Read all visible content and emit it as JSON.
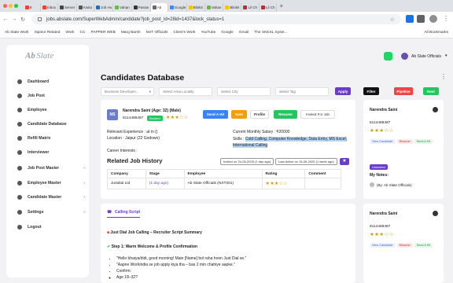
{
  "browser": {
    "tabs": [
      {
        "label": "8",
        "fav": "#ea4335"
      },
      {
        "label": "Inbox",
        "fav": "#ea4335"
      },
      {
        "label": "Server",
        "fav": "#444"
      },
      {
        "label": "Kwita",
        "fav": "#555"
      },
      {
        "label": "Job Ho",
        "fav": "#2b6cb0"
      },
      {
        "label": "Vahan",
        "fav": "#6b4"
      },
      {
        "label": "Passw",
        "fav": "#333"
      },
      {
        "label": "Ab",
        "fav": "#666",
        "active": true
      },
      {
        "label": "Google",
        "fav": "#4285f4"
      },
      {
        "label": "Blinkit",
        "fav": "#f7c600"
      },
      {
        "label": "Vahan",
        "fav": "#6b4"
      },
      {
        "label": "Blinkit",
        "fav": "#f7c600"
      },
      {
        "label": "Lil Ch",
        "fav": "#a33"
      },
      {
        "label": "Lil Ch",
        "fav": "#a33"
      }
    ],
    "new_tab": "+",
    "url": "jobs.abslate.com/SuperWebAdmin/candidate?job_post_id=28id=1437&lock_status=1",
    "bookmarks": [
      "Ab Slate Work",
      "Sipinor Related",
      "Work",
      "CC",
      "PAPPER WEB",
      "Marg Barsh",
      "NST Officials",
      "Client's Work",
      "YouTube",
      "Google",
      "Gmail",
      "The SKESL Syste..."
    ],
    "all_bookmarks": "All Bookmarks"
  },
  "sidebar": {
    "logo_a": "Ab",
    "logo_b": "Slate",
    "items": [
      {
        "label": "Dashboard",
        "chevron": false
      },
      {
        "label": "Job Post",
        "chevron": false
      },
      {
        "label": "Employee",
        "chevron": false
      },
      {
        "label": "Candidate Database",
        "chevron": false
      },
      {
        "label": "Refill Matrix",
        "chevron": false
      },
      {
        "label": "Interviewer",
        "chevron": false
      },
      {
        "label": "Job Post Master",
        "chevron": true
      },
      {
        "label": "Employee Master",
        "chevron": true
      },
      {
        "label": "Candidate Master",
        "chevron": true
      },
      {
        "label": "Settings",
        "chevron": true
      },
      {
        "label": "Logout",
        "chevron": false
      }
    ]
  },
  "header": {
    "title": "Candidates Database",
    "user": "Ab Slate Officials",
    "user_chevron": "▾"
  },
  "filters": {
    "business_dev": "Business Developm...",
    "locality": "Select Area Locality",
    "city": "Select City",
    "tags": "Select Tag",
    "apply": "Apply",
    "filter": "Filter",
    "pipeline": "Pipeline",
    "next": "Next"
  },
  "candidate": {
    "initials": "NS",
    "name_line": "Narendra Saini (Age: 32) (Male)",
    "phone": "8114488487",
    "badge": "Booked",
    "stars": "★★★☆☆",
    "buttons": {
      "send_hi": "Send A Hi!",
      "note": "Note",
      "profile": "Profile",
      "resume": "Resume",
      "invited": "Invited For Job"
    },
    "relevant_exp": "Relevant Experience : at in ()",
    "location": "Location : Jaipur (22 Godown)",
    "career_interests": "Career Interests :",
    "salary": "Current Monthly Salary : ₹20000",
    "skills_label": "Skills :",
    "skills_highlight": "Cold Calling, Computer Knowledge, Data Entry, MS Excel, International Calling",
    "history_title": "Related Job History",
    "invited_tag": "Invited on 24-06-2025 (1 day ago)",
    "last_active": "Last Active on 15-06-2025 (1 week ago)",
    "table": {
      "headers": [
        "Company",
        "Stage",
        "Employee",
        "Rating",
        "Comment"
      ],
      "rows": [
        {
          "company": "Justdial Ltd",
          "stage": "(1 day ago)",
          "employee": "Ab Slate Officials (NST001)",
          "rating": "★★★☆☆",
          "comment": ""
        }
      ]
    }
  },
  "right_cards": [
    {
      "name": "Narendra Saini",
      "phone": "8114488487",
      "stars": "★★★☆☆",
      "btns": [
        "View Candidate",
        "Resume",
        "Send A Hi!"
      ],
      "tag": "Unlocked",
      "notes_title": "My Notes:",
      "note": "(By: Ab Slate Officials)"
    },
    {
      "name": "Narendra Saini",
      "phone": "8114488487",
      "stars": "★★★☆☆",
      "btns": [
        "View Candidate",
        "Resume",
        "Send A Hi!"
      ]
    }
  ],
  "script": {
    "tab": "Calling Script",
    "title": "Just Dial Job Calling – Recruiter Script Summary",
    "step1": "Step 1: Warm Welcome & Profile Confirmation",
    "lines": [
      "\"Hello bhaiya/didi, good morning! Main [Name] bol raha hoon Just Dial se.\"",
      "\"Aapne WorkIndia se job apply kiya tha – bas 2 min chahiye aapke.\"",
      "Confirm:"
    ],
    "sub": [
      "Age 18–32?"
    ]
  }
}
